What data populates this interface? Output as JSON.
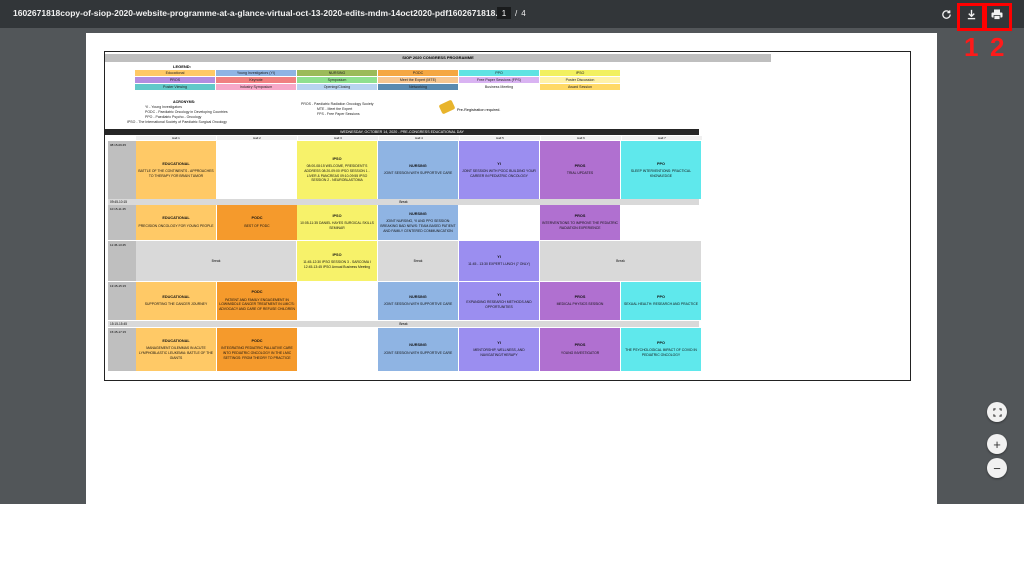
{
  "toolbar": {
    "title": "1602671818copy-of-siop-2020-website-programme-at-a-glance-virtual-oct-13-2020-edits-mdm-14oct2020-pdf1602671818.pdf",
    "current_page": "1",
    "separator": "/",
    "total_pages": "4",
    "icons": [
      "rotate-icon",
      "download-icon",
      "print-icon"
    ],
    "markers": [
      "1",
      "2"
    ],
    "highlight_color": "#ff0000"
  },
  "document": {
    "header": "SIOP 2020 CONGRESS PROGRAMME",
    "legend_title": "LEGEND:",
    "legend": [
      {
        "label": "Educational",
        "color": "#ffc966"
      },
      {
        "label": "Young Investigators (YI)",
        "color": "#8fb4e3"
      },
      {
        "label": "NURSING",
        "color": "#9bbb59"
      },
      {
        "label": "PODC",
        "color": "#f5a742"
      },
      {
        "label": "PPO",
        "color": "#5fe3e3"
      },
      {
        "label": "IPSO",
        "color": "#f2f060"
      },
      {
        "label": "PROS",
        "color": "#b38de0"
      },
      {
        "label": "Keynote",
        "color": "#f08080"
      },
      {
        "label": "Symposium",
        "color": "#8fe08f"
      },
      {
        "label": "Meet the Expert (MTE)",
        "color": "#f7c690"
      },
      {
        "label": "Free Paper Sessions (FPS)",
        "color": "#d9b3f2"
      },
      {
        "label": "Poster Discussion",
        "color": "#fff2a8"
      },
      {
        "label": "Poster Viewing",
        "color": "#62c9c9"
      },
      {
        "label": "Industry Symposium",
        "color": "#f7a8c8"
      },
      {
        "label": "Opening/Closing",
        "color": "#b8d4f0"
      },
      {
        "label": "Networking",
        "color": "#5a8ab0"
      },
      {
        "label": "Business Meeting",
        "color": "#ffffff"
      },
      {
        "label": "Award Session",
        "color": "#ffd966"
      }
    ],
    "acronyms_title": "ACRONYMS:",
    "acronyms_left": [
      "YI - Young Investigators",
      "PODC - Paediatric Oncology in Developing Countries",
      "PPO - Paediatric Psycho - Oncology",
      "IPSO - The International Society of Paediatric Surgical Oncology"
    ],
    "acronyms_right": [
      "PROS - Paediatric Radiation Oncology Society",
      "MTE - Meet the Expert",
      "FPS - Free Paper Sessions"
    ],
    "pre_registration_note": "Pre-Registration required.",
    "day_title": "WEDNESDAY, OCTOBER 14, 2020 - PRE-CONGRESS EDUCATIONAL DAY",
    "halls": [
      "Hall 1",
      "Hall 2",
      "Hall 3",
      "Hall 4",
      "Hall 5",
      "Hall 6",
      "Hall 7"
    ],
    "times": [
      "08:15-09:45",
      "09:45-10:15",
      "10:15-11:45",
      "11:45-13:45",
      "13:45-15:15",
      "15:15-15:45",
      "15:45-17:15"
    ],
    "break_label": "Break",
    "sessions": {
      "r1_edu_title": "EDUCATIONAL",
      "r1_edu_text": "BATTLE OF THE CONTINENTS - APPROACHES TO THERAPY FOR BRAIN TUMOR",
      "r1_ipso_title": "IPSO",
      "r1_ipso_text": "08:00-08:15 WELCOME, PRESIDENT'S ADDRESS 08:20-09:00 IPSO SESSION 1 - LIVER & PANCREAS 09:10-09:55 IPSO SESSION 2 - NEUROBLASTOMA",
      "r1_nursing_title": "NURSING",
      "r1_nursing_text": "JOINT SESSION WITH SUPPORTIVE CARE",
      "r1_yi_title": "YI",
      "r1_yi_text": "JOINT SESSION WITH PODC BUILDING YOUR CAREER IN PEDIATRIC ONCOLOGY",
      "r1_pros_title": "PROS",
      "r1_pros_text": "TRIAL UPDATES",
      "r1_ppo_title": "PPO",
      "r1_ppo_text": "SLEEP INTERVENTIONS: PRACTICAL KNOWLEDGE",
      "r2_edu_title": "EDUCATIONAL",
      "r2_edu_text": "PRECISION ONCOLOGY FOR YOUNG PEOPLE",
      "r2_podc_title": "PODC",
      "r2_podc_text": "BEST OF PODC",
      "r2_ipso_title": "IPSO",
      "r2_ipso_text": "10:05-11:35 DANIEL HAYES SURGICAL SKILLS SEMINAR",
      "r2_nursing_title": "NURSING",
      "r2_nursing_text": "JOINT NURSING, YI AND PPO SESSION: BREAKING BAD NEWS: TEAM-BASED PATIENT AND FAMILY CENTERED COMMUNICATION",
      "r2_pros_title": "PROS",
      "r2_pros_text": "INTERVENTIONS TO IMPROVE THE PEDIATRIC RADIATION EXPERIENCE",
      "r3_ipso_title": "IPSO",
      "r3_ipso_text": "11:45-12:30 IPSO SESSION 3 - SARCOMA I 12:45-13:45 IPSO Annual Business Meeting",
      "r3_yi_title": "YI",
      "r3_yi_text": "11:45 - 13:30 EXPERT LUNCH (7 ONLY)",
      "r4_edu_title": "EDUCATIONAL",
      "r4_edu_text": "SUPPORTING THE CANCER JOURNEY",
      "r4_podc_title": "PODC",
      "r4_podc_text": "PATIENT AND FAMILY ENGAGEMENT IN LOW/MIDDLE CANCER TREATMENT IN LMIC'S: ADVOCACY AND CARE OF REFUSE CHILDREN",
      "r4_nursing_title": "NURSING",
      "r4_nursing_text": "JOINT SESSION WITH SUPPORTIVE CARE",
      "r4_yi_title": "YI",
      "r4_yi_text": "EXPANDING RESEARCH METHODS AND OPPORTUNITIES",
      "r4_pros_title": "PROS",
      "r4_pros_text": "MEDICAL PHYSICS SESSION",
      "r4_ppo_title": "PPO",
      "r4_ppo_text": "SEXUAL HEALTH: RESEARCH AND PRACTICE",
      "r5_edu_title": "EDUCATIONAL",
      "r5_edu_text": "MANAGEMENT DILEMMAS IN ACUTE LYMPHOBLASTIC LEUKEMIA: BATTLE OF THE GIANTS",
      "r5_podc_title": "PODC",
      "r5_podc_text": "INTEGRATING PEDIATRIC PALLIATIVE CARE INTO PEDIATRIC ONCOLOGY IN THE LMIC SETTINGS: FROM THEORY TO PRACTICE",
      "r5_nursing_title": "NURSING",
      "r5_nursing_text": "JOINT SESSION WITH SUPPORTIVE CARE",
      "r5_yi_title": "YI",
      "r5_yi_text": "MENTORSHIP, WELLNESS, AND NAVIGATING/THERAPY",
      "r5_pros_title": "PROS",
      "r5_pros_text": "YOUNG INVESTIGATOR",
      "r5_ppo_title": "PPO",
      "r5_ppo_text": "THE PSYCHOLOGICAL IMPACT OF COVID IN PEDIATRIC ONCOLOGY"
    }
  },
  "controls": {
    "fit_icon": "fit-page-icon",
    "zoom_in": "+",
    "zoom_out": "−"
  }
}
